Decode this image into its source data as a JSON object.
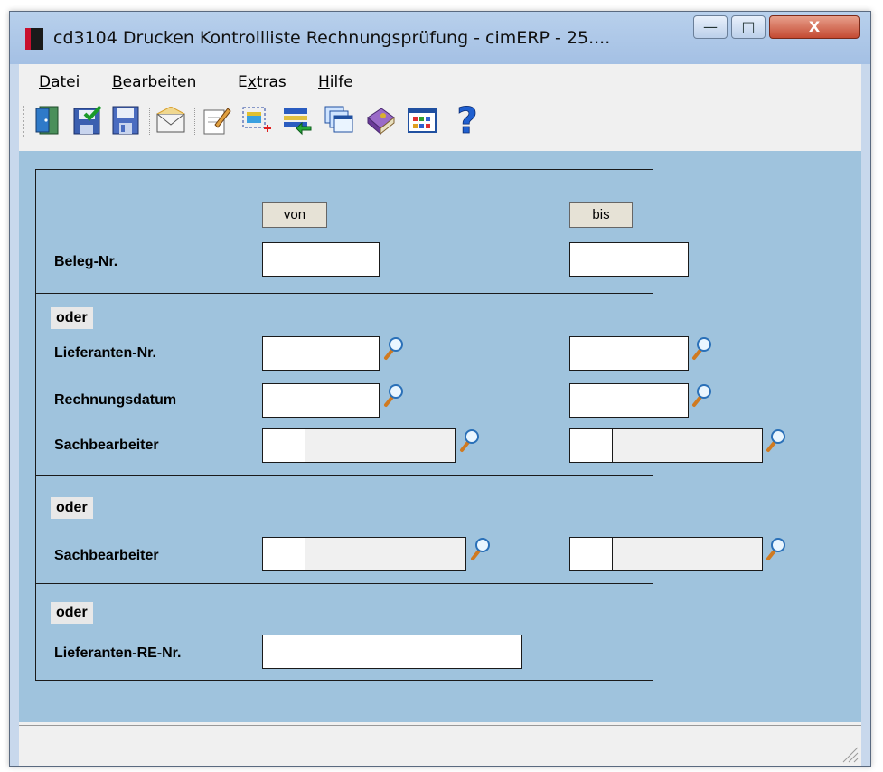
{
  "window": {
    "title": "cd3104 Drucken Kontrollliste Rechnungsprüfung - cimERP - 25....",
    "minimize_label": "—",
    "maximize_label": "□",
    "close_label": "X"
  },
  "menu": [
    {
      "hot": "D",
      "rest": "atei"
    },
    {
      "hot": "B",
      "rest": "earbeiten"
    },
    {
      "hot": "E",
      "rest": "xtras",
      "underline_index": 1
    },
    {
      "hot": "H",
      "rest": "ilfe"
    }
  ],
  "menu_display": {
    "datei_u": "D",
    "datei_r": "atei",
    "bearbeiten_u": "B",
    "bearbeiten_r": "earbeiten",
    "extras_a": "E",
    "extras_u": "x",
    "extras_r": "tras",
    "hilfe_u": "H",
    "hilfe_r": "ilfe"
  },
  "toolbar_icons": [
    "exit-door-icon",
    "save-check-icon",
    "save-icon",
    "mail-icon",
    "edit-document-icon",
    "new-record-icon",
    "list-import-icon",
    "windows-cascade-icon",
    "book-icon",
    "grid-table-icon",
    "help-icon"
  ],
  "form": {
    "von_label": "von",
    "bis_label": "bis",
    "beleg_label": "Beleg-Nr.",
    "oder_label": "oder",
    "lieferant_label": "Lieferanten-Nr.",
    "rechnungsdatum_label": "Rechnungsdatum",
    "sachbearbeiter_label": "Sachbearbeiter",
    "lieferant_re_label": "Lieferanten-RE-Nr.",
    "fields": {
      "beleg_von": "",
      "beleg_bis": "",
      "lieferant_von": "",
      "lieferant_bis": "",
      "rdatum_von": "",
      "rdatum_bis": "",
      "sb1_von_code": "",
      "sb1_von_name": "",
      "sb1_bis_code": "",
      "sb1_bis_name": "",
      "sb2_von_code": "",
      "sb2_von_name": "",
      "sb2_bis_code": "",
      "sb2_bis_name": "",
      "lieferant_re": ""
    }
  },
  "colors": {
    "form_bg": "#9fc3dd",
    "title_bar": "#b8d0ec",
    "close_button": "#c44a32"
  }
}
